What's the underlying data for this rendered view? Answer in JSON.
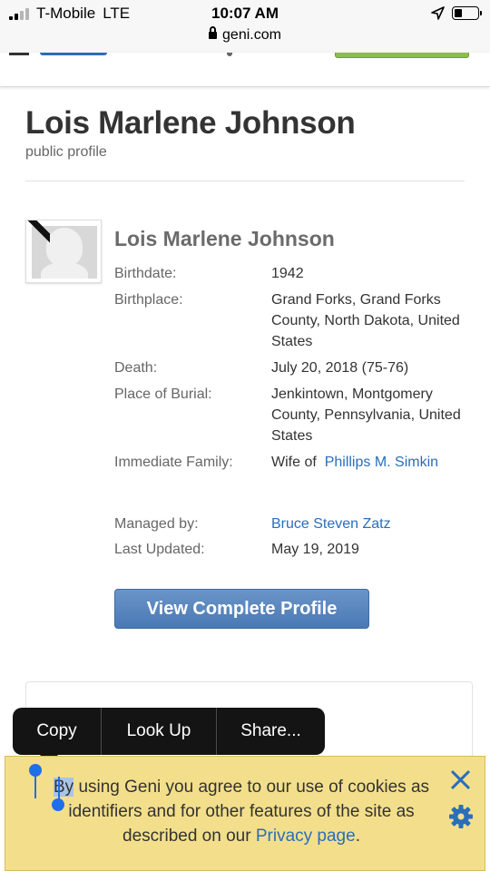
{
  "status_bar": {
    "carrier": "T-Mobile",
    "network": "LTE",
    "time": "10:07 AM",
    "url": "geni.com",
    "battery_level": 0.35
  },
  "page": {
    "title": "Lois Marlene Johnson",
    "subtitle": "public profile"
  },
  "profile": {
    "name": "Lois Marlene Johnson",
    "fields": {
      "birthdate_label": "Birthdate:",
      "birthdate_value": "1942",
      "birthplace_label": "Birthplace:",
      "birthplace_value": "Grand Forks, Grand Forks County, North Dakota, United States",
      "death_label": "Death:",
      "death_value": "July 20, 2018 (75-76)",
      "burial_label": "Place of Burial:",
      "burial_value": "Jenkintown, Montgomery County, Pennsylvania, United States",
      "family_label": "Immediate Family:",
      "family_prefix": "Wife of",
      "family_link": "Phillips M. Simkin",
      "managed_label": "Managed by:",
      "managed_link": "Bruce Steven Zatz",
      "updated_label": "Last Updated:",
      "updated_value": "May 19, 2019"
    },
    "view_button": "View Complete Profile"
  },
  "context_menu": {
    "copy": "Copy",
    "look_up": "Look Up",
    "share": "Share..."
  },
  "cookie_banner": {
    "selected_word": "By",
    "text": "using Geni you agree to our use of cookies as identifiers and for other features of the site as described on our",
    "link": "Privacy page",
    "end": "."
  },
  "colors": {
    "link": "#2a6ebb",
    "button": "#4a78b3",
    "banner": "#f3df8b",
    "selection": "#1f6fe8"
  }
}
